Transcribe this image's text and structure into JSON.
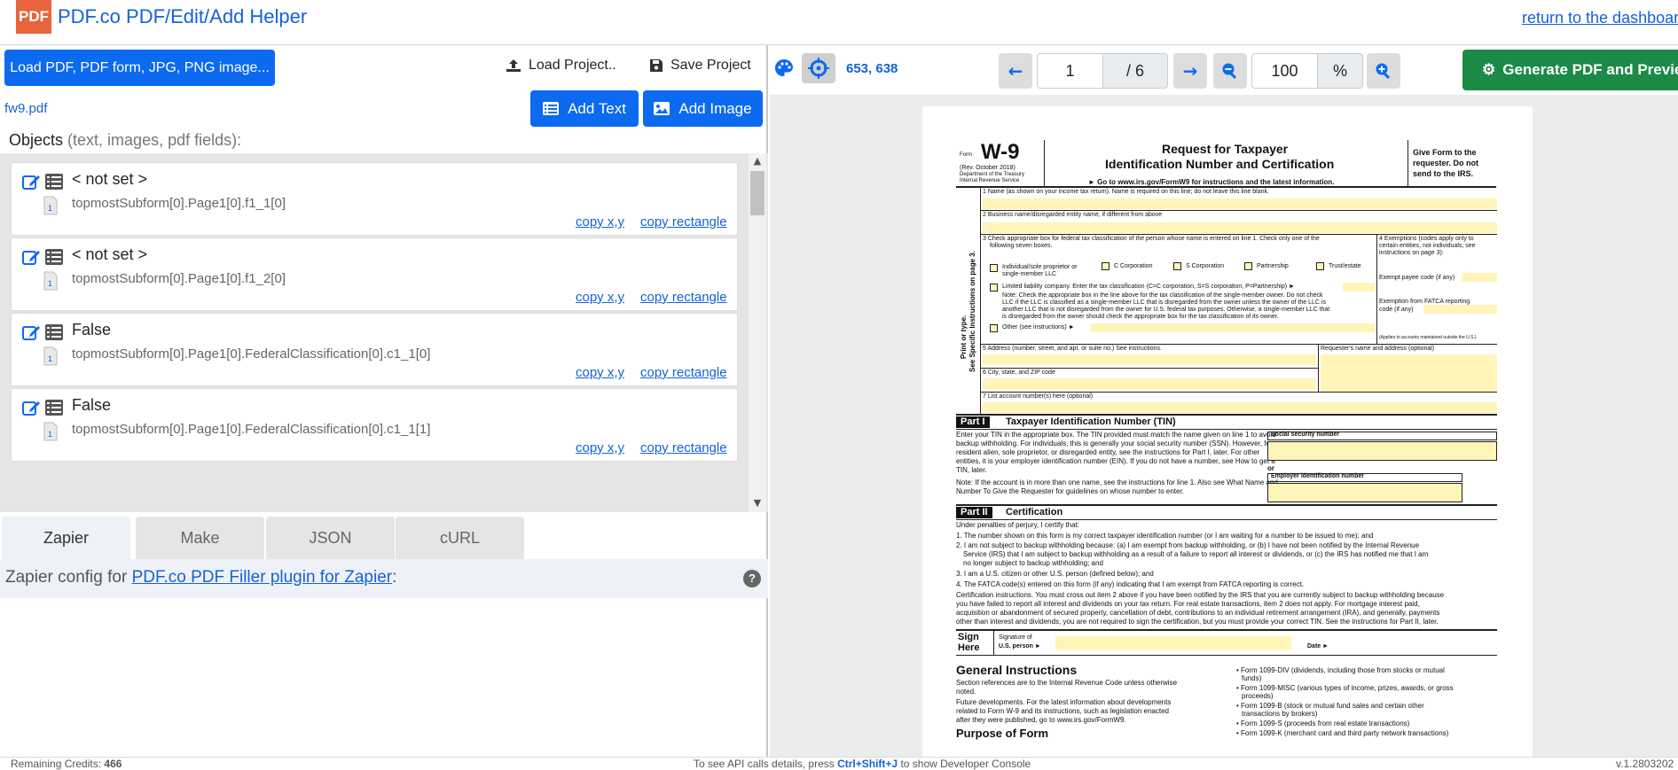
{
  "header": {
    "logo_text": "PDF",
    "title": "PDF.co PDF/Edit/Add Helper",
    "dashboard_link": "return to the dashboard"
  },
  "left_panel": {
    "load_button": "Load PDF, PDF form, JPG, PNG image...",
    "load_project": "Load Project..",
    "save_project": "Save Project",
    "file_name": "fw9.pdf",
    "add_text": "Add Text",
    "add_image": "Add Image",
    "objects_title": "Objects",
    "objects_subtitle": "(text, images, pdf fields):",
    "objects": [
      {
        "value": "< not set >",
        "field": "topmostSubform[0].Page1[0].f1_1[0]",
        "page": "1",
        "copy_xy": "copy x,y",
        "copy_rect": "copy rectangle"
      },
      {
        "value": "< not set >",
        "field": "topmostSubform[0].Page1[0].f1_2[0]",
        "page": "1",
        "copy_xy": "copy x,y",
        "copy_rect": "copy rectangle"
      },
      {
        "value": "False",
        "field": "topmostSubform[0].Page1[0].FederalClassification[0].c1_1[0]",
        "page": "1",
        "copy_xy": "copy x,y",
        "copy_rect": "copy rectangle"
      },
      {
        "value": "False",
        "field": "topmostSubform[0].Page1[0].FederalClassification[0].c1_1[1]",
        "page": "1",
        "copy_xy": "copy x,y",
        "copy_rect": "copy rectangle"
      }
    ],
    "tabs": [
      {
        "label": "Zapier",
        "active": true
      },
      {
        "label": "Make",
        "active": false
      },
      {
        "label": "JSON",
        "active": false
      },
      {
        "label": "cURL",
        "active": false
      }
    ],
    "zapier_prefix": "Zapier config for",
    "zapier_link": "PDF.co PDF Filler plugin for Zapier",
    "zapier_suffix": ":",
    "help_icon": "?"
  },
  "viewer": {
    "coords": "653, 638",
    "page_current": "1",
    "page_total": "/ 6",
    "zoom": "100",
    "zoom_unit": "%",
    "generate_button": "Generate PDF and Preview"
  },
  "pdf": {
    "form_label": "Form",
    "form_name": "W-9",
    "rev": "(Rev. October 2018)",
    "dept": "Department of the Treasury",
    "irs": "Internal Revenue Service",
    "title_line1": "Request for Taxpayer",
    "title_line2": "Identification Number and Certification",
    "goto": "► Go to www.irs.gov/FormW9 for instructions and the latest information.",
    "give_form_1": "Give Form to the",
    "give_form_2": "requester. Do not",
    "give_form_3": "send to the IRS.",
    "line1": "1  Name (as shown on your income tax return). Name is required on this line; do not leave this line blank.",
    "line2": "2  Business name/disregarded entity name, if different from above",
    "line3a": "3  Check appropriate box for federal tax classification of the person whose name is entered on line 1. Check only one of the",
    "line3b": "following seven boxes.",
    "line4a": "4  Exemptions (codes apply only to",
    "line4b": "certain entities, not individuals; see",
    "line4c": "instructions on page 3):",
    "exempt_payee": "Exempt payee code (if any)",
    "fatca1": "Exemption from FATCA reporting",
    "fatca2": "code (if any)",
    "applies": "(Applies to accounts maintained outside the U.S.)",
    "cls_individual_1": "Individual/sole proprietor or",
    "cls_individual_2": "single-member LLC",
    "cls_c": "C Corporation",
    "cls_s": "S Corporation",
    "cls_partnership": "Partnership",
    "cls_trust": "Trust/estate",
    "llc": "Limited liability company. Enter the tax classification (C=C corporation, S=S corporation, P=Partnership) ►",
    "note1": "Note: Check the appropriate box in the line above for the tax classification of the single-member owner.  Do not check",
    "note2": "LLC if the LLC is classified as a single-member LLC that is disregarded from the owner unless the owner of the LLC is",
    "note3": "another LLC that is not disregarded from the owner for U.S. federal tax purposes. Otherwise, a single-member LLC that",
    "note4": "is disregarded from the owner should check the appropriate box for the tax classification of its owner.",
    "other": "Other (see instructions) ►",
    "side_label1": "Print or type.",
    "side_label2": "See Specific Instructions on page 3.",
    "line5": "5  Address (number, street, and apt. or suite no.) See instructions.",
    "requester": "Requester's name and address (optional)",
    "line6": "6  City, state, and ZIP code",
    "line7": "7  List account number(s) here (optional)",
    "part1_tag": "Part I",
    "part1_title": "Taxpayer Identification Number (TIN)",
    "tin1": "Enter your TIN in the appropriate box. The TIN provided must match the name given on line 1 to avoid",
    "tin2": "backup withholding. For individuals, this is generally your social security number (SSN). However, for a",
    "tin3": "resident alien, sole proprietor, or disregarded entity, see the instructions for Part I, later. For other",
    "tin4": "entities, it is your employer identification number (EIN). If you do not have a number, see How to get a",
    "tin5": "TIN, later.",
    "tin_note1": "Note: If the account is in more than one name, see the instructions for line 1. Also see What Name and",
    "tin_note2": "Number To Give the Requester for guidelines on whose number to enter.",
    "ssn_label": "Social security number",
    "or_label": "or",
    "ein_label": "Employer identification number",
    "part2_tag": "Part II",
    "part2_title": "Certification",
    "cert_intro": "Under penalties of perjury, I certify that:",
    "cert1": "1. The number shown on this form is my correct taxpayer identification number (or I am waiting for a number to be issued to me); and",
    "cert2a": "2. I am not subject to backup withholding because: (a) I am exempt from backup withholding, or (b) I have not been notified by the Internal Revenue",
    "cert2b": "Service (IRS) that I am subject to backup withholding as a result of a failure to report all interest or dividends, or (c) the IRS has notified me that I am",
    "cert2c": "no longer subject to backup withholding; and",
    "cert3": "3. I am a U.S. citizen or other U.S. person (defined below); and",
    "cert4": "4. The FATCA code(s) entered on this form (if any) indicating that I am exempt from FATCA reporting is correct.",
    "ci1": "Certification instructions. You must cross out item 2 above if you have been notified by the IRS that you are currently subject to backup withholding because",
    "ci2": "you have failed to report all interest and dividends on your tax return. For real estate transactions, item 2 does not apply. For mortgage interest paid,",
    "ci3": "acquisition or abandonment of secured property, cancellation of debt, contributions to an individual retirement arrangement (IRA), and generally, payments",
    "ci4": "other than interest and dividends, you are not required to sign the certification, but you must provide your correct TIN. See the instructions for Part II, later.",
    "sign": "Sign",
    "here": "Here",
    "sig_of": "Signature of",
    "us_person": "U.S. person ►",
    "date": "Date ►",
    "gen_instr": "General Instructions",
    "gi1": "Section references are to the Internal Revenue Code unless otherwise",
    "gi2": "noted.",
    "fd1": "Future developments. For the latest information about developments",
    "fd2": "related to Form W-9 and its instructions, such as legislation enacted",
    "fd3": "after they were published, go to www.irs.gov/FormW9.",
    "purpose": "Purpose of Form",
    "b1a": "• Form 1099-DIV (dividends, including those from stocks or mutual",
    "b1b": "funds)",
    "b2a": "• Form 1099-MISC (various types of income, prizes, awards, or gross",
    "b2b": "proceeds)",
    "b3a": "• Form 1099-B (stock or mutual fund sales and certain other",
    "b3b": "transactions by brokers)",
    "b4": "• Form 1099-S (proceeds from real estate transactions)",
    "b5": "• Form 1099-K (merchant card and third party network transactions)"
  },
  "status": {
    "credits_label": "Remaining Credits:",
    "credits_value": "466",
    "hint_prefix": "To see API calls details, press",
    "hint_keys": "Ctrl+Shift+J",
    "hint_suffix": "to show Developer Console",
    "version": "v.1.2803202"
  },
  "colors": {
    "accent_blue": "#0b6af0",
    "link_blue": "#1462d8",
    "generate_green": "#1c8a47",
    "logo_orange": "#e8643a",
    "form_field_yellow": "#fff5b8"
  }
}
